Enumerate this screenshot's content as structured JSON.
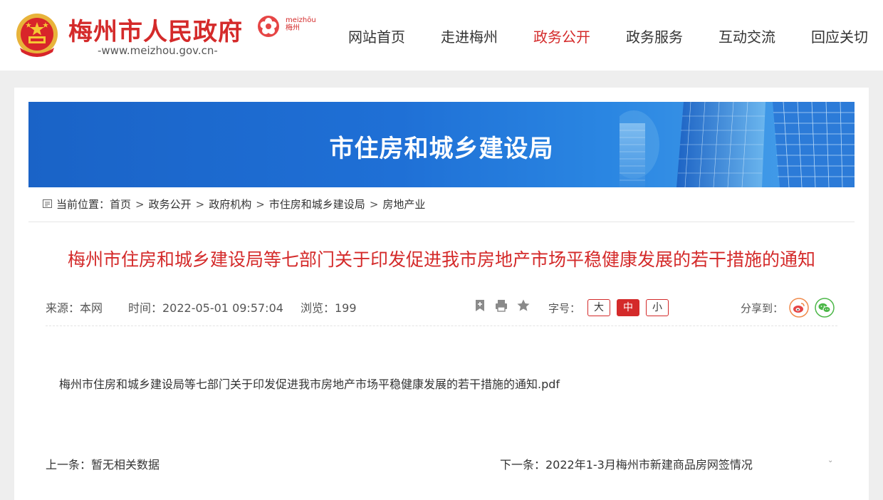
{
  "header": {
    "site_title": "梅州市人民政府",
    "site_url": "-www.meizhou.gov.cn-",
    "city_logo_text_top": "meizhōu",
    "city_logo_text_bottom": "梅州",
    "nav": [
      {
        "label": "网站首页",
        "active": false
      },
      {
        "label": "走进梅州",
        "active": false
      },
      {
        "label": "政务公开",
        "active": true
      },
      {
        "label": "政务服务",
        "active": false
      },
      {
        "label": "互动交流",
        "active": false
      },
      {
        "label": "回应关切",
        "active": false
      }
    ],
    "accent_color": "#d42a2a"
  },
  "banner": {
    "title": "市住房和城乡建设局",
    "background_color": "#1f70d6"
  },
  "breadcrumb": {
    "prefix": "当前位置：",
    "items": [
      "首页",
      "政务公开",
      "政府机构",
      "市住房和城乡建设局",
      "房地产业"
    ],
    "separator": ">"
  },
  "article": {
    "title": "梅州市住房和城乡建设局等七部门关于印发促进我市房地产市场平稳健康发展的若干措施的通知",
    "source": "来源：本网",
    "time": "时间：2022-05-01 09:57:04",
    "views": "浏览：199",
    "font_size_label": "字号：",
    "font_sizes": [
      "大",
      "中",
      "小"
    ],
    "selected_font_size": "中",
    "share_label": "分享到：",
    "attachment": "梅州市住房和城乡建设局等七部门关于印发促进我市房地产市场平稳健康发展的若干措施的通知.pdf",
    "prev": "上一条：暂无相关数据",
    "next": "下一条：2022年1-3月梅州市新建商品房网签情况"
  },
  "icons": {
    "tools": [
      "bookmark-icon",
      "print-icon",
      "star-icon"
    ],
    "share": [
      "weibo-icon",
      "wechat-icon"
    ]
  }
}
